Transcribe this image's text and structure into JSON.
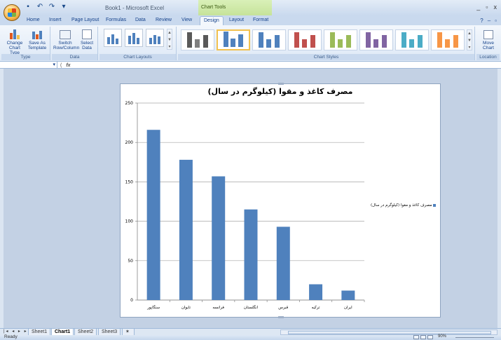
{
  "window": {
    "title": "Book1 - Microsoft Excel",
    "context_title": "Chart Tools",
    "minimize": "_",
    "restore": "▫",
    "close": "x"
  },
  "qat": {
    "save": "save-icon",
    "undo": "undo-icon",
    "redo": "redo-icon",
    "customize": "customize-icon"
  },
  "tabs": [
    "Home",
    "Insert",
    "Page Layout",
    "Formulas",
    "Data",
    "Review",
    "View",
    "Design",
    "Layout",
    "Format"
  ],
  "active_tab": "Design",
  "ribbon": {
    "type_group": {
      "label": "Type",
      "change_chart_type": "Change Chart Type",
      "save_as_template": "Save As Template"
    },
    "data_group": {
      "label": "Data",
      "switch_row_column": "Switch Row/Column",
      "select_data": "Select Data"
    },
    "layouts_group": {
      "label": "Chart Layouts"
    },
    "styles_group": {
      "label": "Chart Styles",
      "styles": [
        {
          "colors": [
            "#595959",
            "#7f7f7f",
            "#595959"
          ]
        },
        {
          "colors": [
            "#4f81bd",
            "#4f81bd",
            "#4f81bd"
          ]
        },
        {
          "colors": [
            "#4f81bd",
            "#4f81bd",
            "#4f81bd"
          ]
        },
        {
          "colors": [
            "#c0504d",
            "#c0504d",
            "#c0504d"
          ]
        },
        {
          "colors": [
            "#9bbb59",
            "#9bbb59",
            "#9bbb59"
          ]
        },
        {
          "colors": [
            "#8064a2",
            "#8064a2",
            "#8064a2"
          ]
        },
        {
          "colors": [
            "#4bacc6",
            "#4bacc6",
            "#4bacc6"
          ]
        },
        {
          "colors": [
            "#f79646",
            "#f79646",
            "#f79646"
          ]
        }
      ]
    },
    "location_group": {
      "label": "Location",
      "move_chart": "Move Chart"
    }
  },
  "formula_bar": {
    "fx": "fx"
  },
  "chart_data": {
    "type": "bar",
    "title": "مصرف کاغذ و مقوا (کیلوگرم در سال)",
    "categories": [
      "سنگاپور",
      "تایوان",
      "فرانسه",
      "انگلستان",
      "قبرس",
      "ترکیه",
      "ایران"
    ],
    "series": [
      {
        "name": "مصرف کاغذ و مقوا (کیلوگرم در سال)",
        "values": [
          216,
          178,
          157,
          115,
          93,
          20,
          12
        ],
        "color": "#4f81bd"
      }
    ],
    "ylim": [
      0,
      250
    ],
    "yticks": [
      0,
      50,
      100,
      150,
      200,
      250
    ],
    "grid": true,
    "legend": "right"
  },
  "sheets": [
    "Sheet1",
    "Chart1",
    "Sheet2",
    "Sheet3"
  ],
  "active_sheet": "Chart1",
  "status": {
    "text": "Ready",
    "zoom": "90%"
  }
}
